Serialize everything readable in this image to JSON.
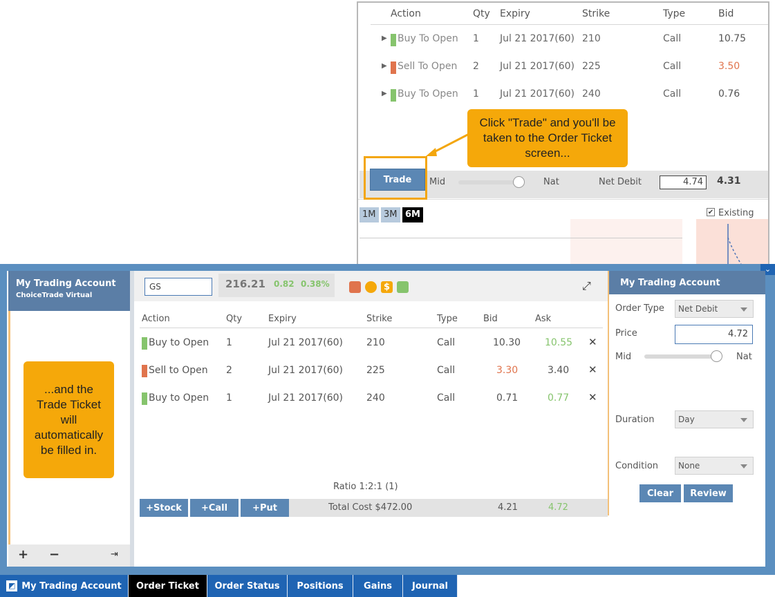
{
  "option_chain": {
    "headers": [
      "Action",
      "Qty",
      "Expiry",
      "Strike",
      "Type",
      "Bid"
    ],
    "rows": [
      {
        "action": "Buy To Open",
        "qty": "1",
        "expiry": "Jul 21 2017(60)",
        "strike": "210",
        "type": "Call",
        "bid": "10.75",
        "bar_color": "#86c46d",
        "bid_color": "#555555"
      },
      {
        "action": "Sell To Open",
        "qty": "2",
        "expiry": "Jul 21 2017(60)",
        "strike": "225",
        "type": "Call",
        "bid": "3.50",
        "bar_color": "#e0744d",
        "bid_color": "#e0744d"
      },
      {
        "action": "Buy To Open",
        "qty": "1",
        "expiry": "Jul 21 2017(60)",
        "strike": "240",
        "type": "Call",
        "bid": "0.76",
        "bar_color": "#86c46d",
        "bid_color": "#555555"
      }
    ],
    "trade_label": "Trade",
    "mid_label": "Mid",
    "nat_label": "Nat",
    "net_debit_label": "Net Debit",
    "net_debit_value": "4.74",
    "net_value": "4.31",
    "ranges": [
      "1M",
      "3M",
      "6M"
    ],
    "active_range": "6M",
    "existing_label": "Existing"
  },
  "callouts": {
    "trade": "Click \"Trade\" and you'll be taken to the Order Ticket screen...",
    "ticket": "...and the Trade Ticket will automatically be filled in."
  },
  "sidebar": {
    "title": "My Trading Account",
    "subtitle": "ChoiceTrade Virtual",
    "footer_icons": [
      "plus-icon",
      "minus-icon",
      "exit-icon"
    ]
  },
  "ticket": {
    "symbol": "GS",
    "price": "216.21",
    "change": "0.82",
    "change_pct": "0.38%",
    "headers": [
      "Action",
      "Qty",
      "Expiry",
      "Strike",
      "Type",
      "Bid",
      "Ask"
    ],
    "rows": [
      {
        "action": "Buy to Open",
        "qty": "1",
        "expiry": "Jul 21 2017(60)",
        "strike": "210",
        "type": "Call",
        "bid": "10.30",
        "ask": "10.55",
        "bar_color": "#86c46d",
        "bid_color": "#555555",
        "ask_color": "#86c46d"
      },
      {
        "action": "Sell to Open",
        "qty": "2",
        "expiry": "Jul 21 2017(60)",
        "strike": "225",
        "type": "Call",
        "bid": "3.30",
        "ask": "3.40",
        "bar_color": "#e0744d",
        "bid_color": "#e0744d",
        "ask_color": "#555555"
      },
      {
        "action": "Buy to Open",
        "qty": "1",
        "expiry": "Jul 21 2017(60)",
        "strike": "240",
        "type": "Call",
        "bid": "0.71",
        "ask": "0.77",
        "bar_color": "#86c46d",
        "bid_color": "#555555",
        "ask_color": "#86c46d"
      }
    ],
    "remove_label": "✕",
    "ratio": "Ratio 1:2:1 (1)",
    "add_stock": "+Stock",
    "add_call": "+Call",
    "add_put": "+Put",
    "total_cost": "Total Cost $472.00",
    "total_bid": "4.21",
    "total_ask": "4.72"
  },
  "order": {
    "title": "My Trading Account",
    "order_type_label": "Order Type",
    "order_type_value": "Net Debit",
    "price_label": "Price",
    "price_value": "4.72",
    "mid_label": "Mid",
    "nat_label": "Nat",
    "duration_label": "Duration",
    "duration_value": "Day",
    "condition_label": "Condition",
    "condition_value": "None",
    "clear_label": "Clear",
    "review_label": "Review"
  },
  "tabs": [
    {
      "label": "My Trading Account",
      "active": false
    },
    {
      "label": "Order Ticket",
      "active": true
    },
    {
      "label": "Order Status",
      "active": false
    },
    {
      "label": "Positions",
      "active": false
    },
    {
      "label": "Gains",
      "active": false
    },
    {
      "label": "Journal",
      "active": false
    }
  ],
  "colors": {
    "accent_blue": "#5b87b4",
    "positive": "#86c46d",
    "negative": "#e0744d",
    "callout": "#f5a80a",
    "tab_bar": "#1f64b3"
  }
}
